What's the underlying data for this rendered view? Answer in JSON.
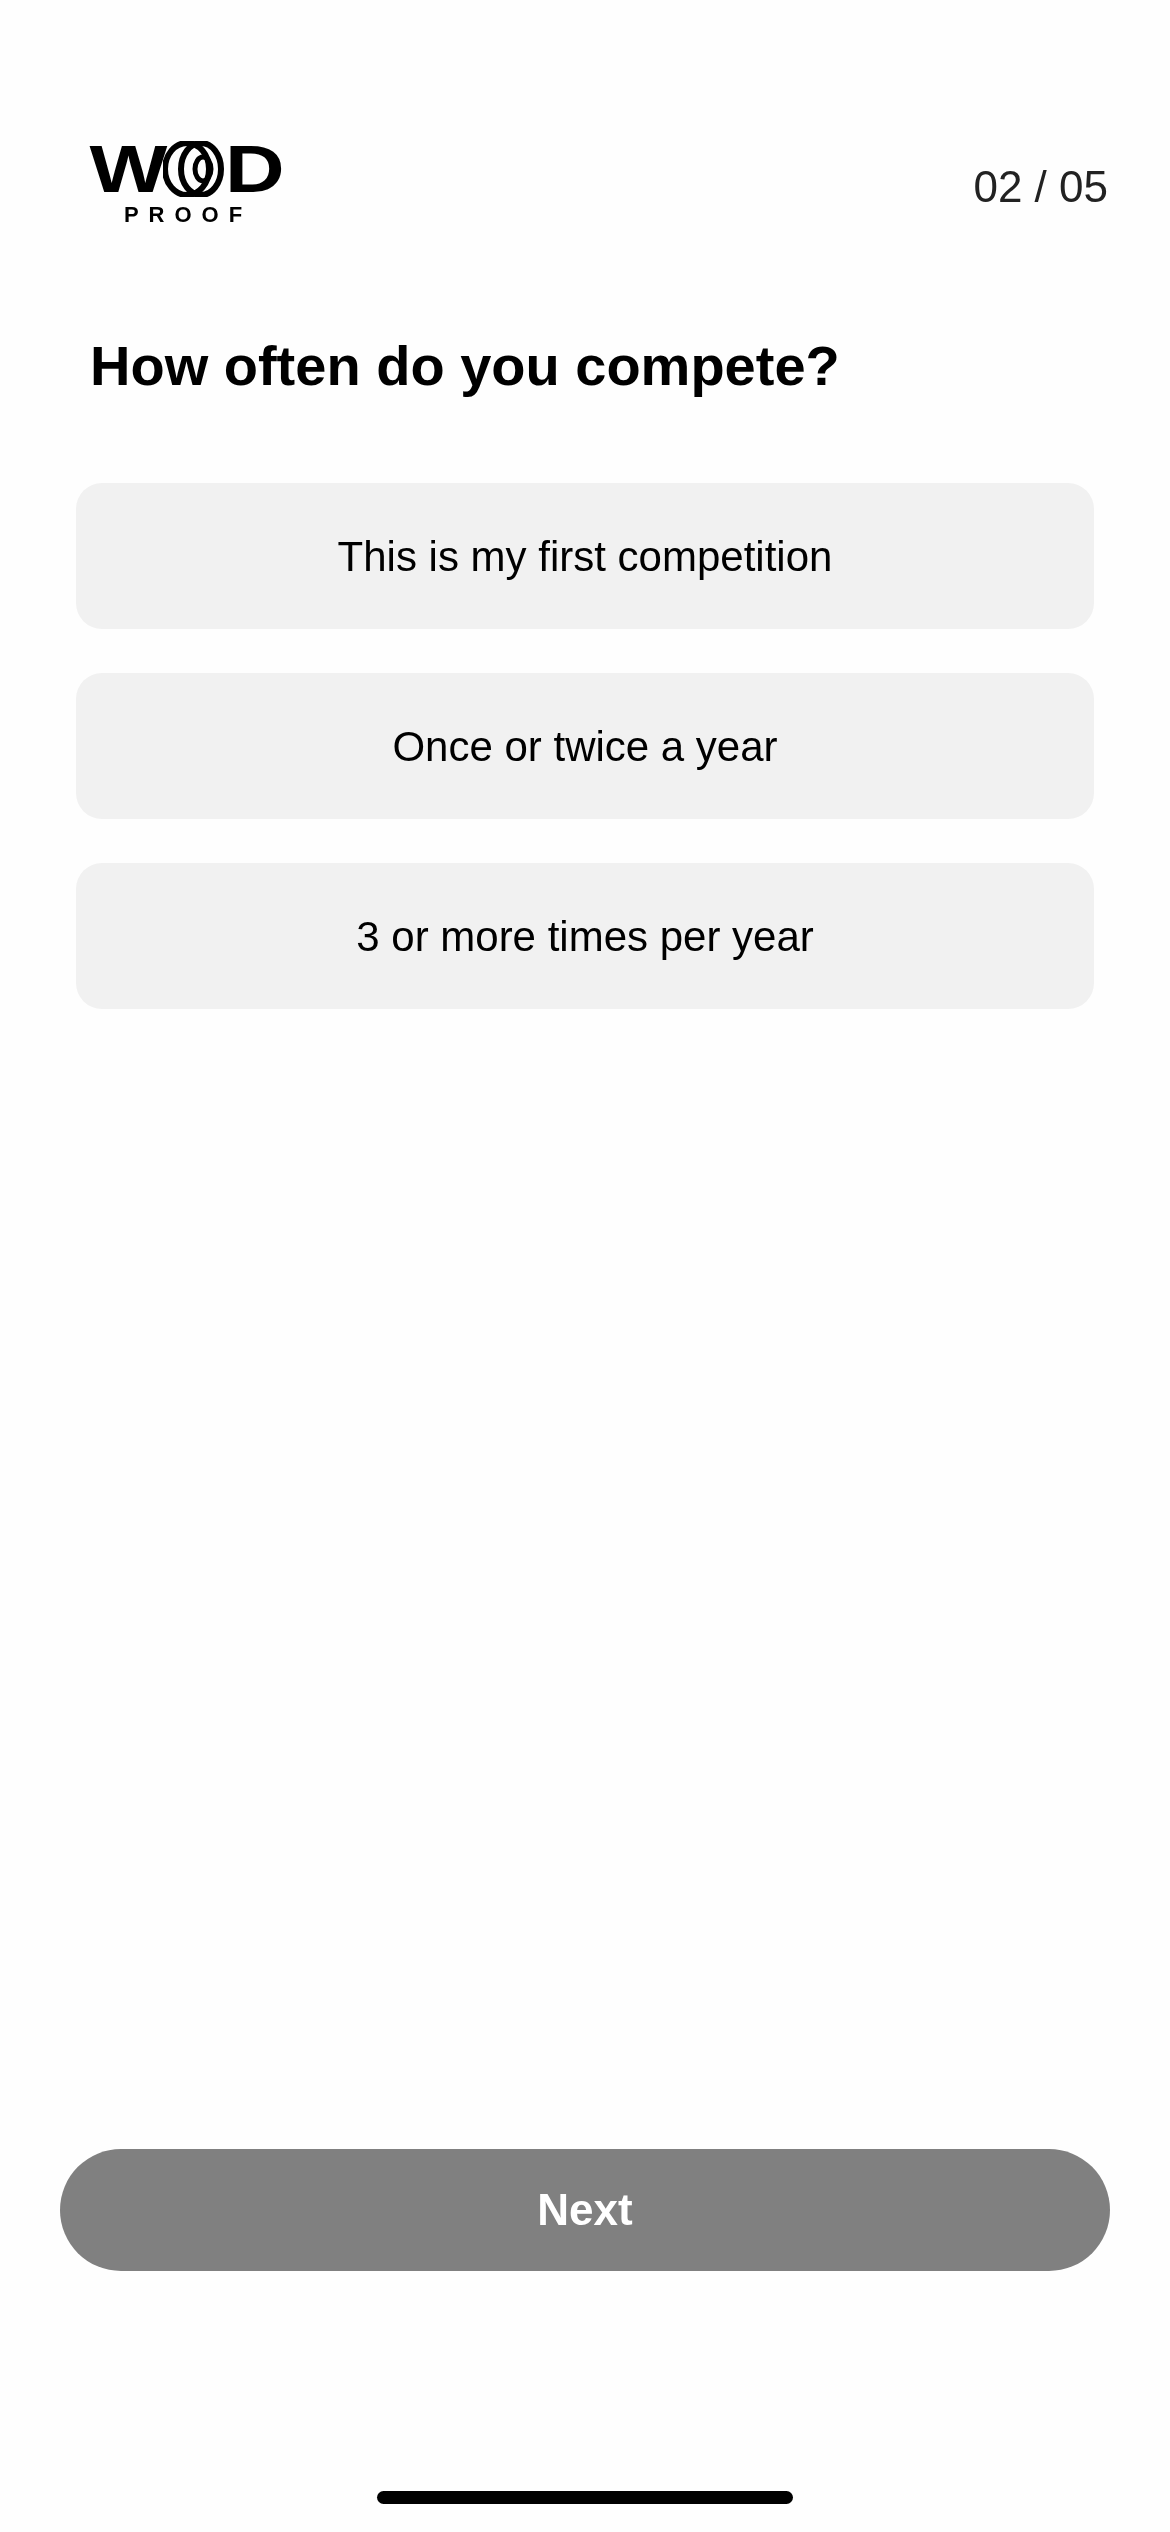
{
  "header": {
    "logo": {
      "lead": "W",
      "tail": "D",
      "tagline": "PROOF"
    },
    "step_counter": "02 / 05"
  },
  "question": "How often do you compete?",
  "options": [
    {
      "label": "This is my first competition",
      "selected": false
    },
    {
      "label": "Once or twice a year",
      "selected": false
    },
    {
      "label": "3 or more times per year",
      "selected": false
    }
  ],
  "next_button": {
    "label": "Next",
    "disabled": true
  }
}
